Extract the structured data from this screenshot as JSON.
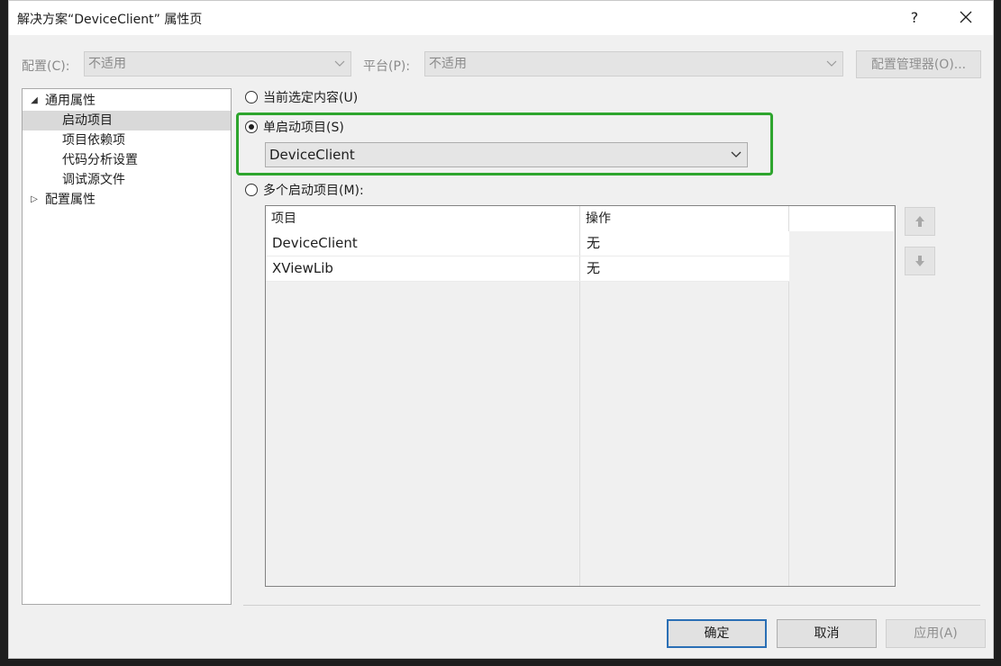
{
  "window": {
    "title": "解决方案“DeviceClient” 属性页",
    "help_label": "?"
  },
  "config_bar": {
    "config_label": "配置(C):",
    "config_value": "不适用",
    "platform_label": "平台(P):",
    "platform_value": "不适用",
    "config_manager_label": "配置管理器(O)..."
  },
  "tree": {
    "items": [
      {
        "label": "通用属性",
        "expanded": true,
        "level": 0
      },
      {
        "label": "启动项目",
        "selected": true,
        "level": 1
      },
      {
        "label": "项目依赖项",
        "level": 1
      },
      {
        "label": "代码分析设置",
        "level": 1
      },
      {
        "label": "调试源文件",
        "level": 1
      },
      {
        "label": "配置属性",
        "expanded": false,
        "level": 0
      }
    ]
  },
  "startup": {
    "current_selection_label": "当前选定内容(U)",
    "single_label": "单启动项目(S)",
    "single_value": "DeviceClient",
    "multiple_label": "多个启动项目(M):",
    "selected_option": "single"
  },
  "grid": {
    "columns": [
      "项目",
      "操作"
    ],
    "rows": [
      {
        "project": "DeviceClient",
        "action": "无"
      },
      {
        "project": "XViewLib",
        "action": "无"
      }
    ]
  },
  "buttons": {
    "ok": "确定",
    "cancel": "取消",
    "apply": "应用(A)"
  },
  "icons": {
    "up": "arrow-up-icon",
    "down": "arrow-down-icon",
    "close": "close-icon"
  },
  "colors": {
    "highlight": "#2ea52e",
    "default_button_border": "#2a6fb5"
  }
}
